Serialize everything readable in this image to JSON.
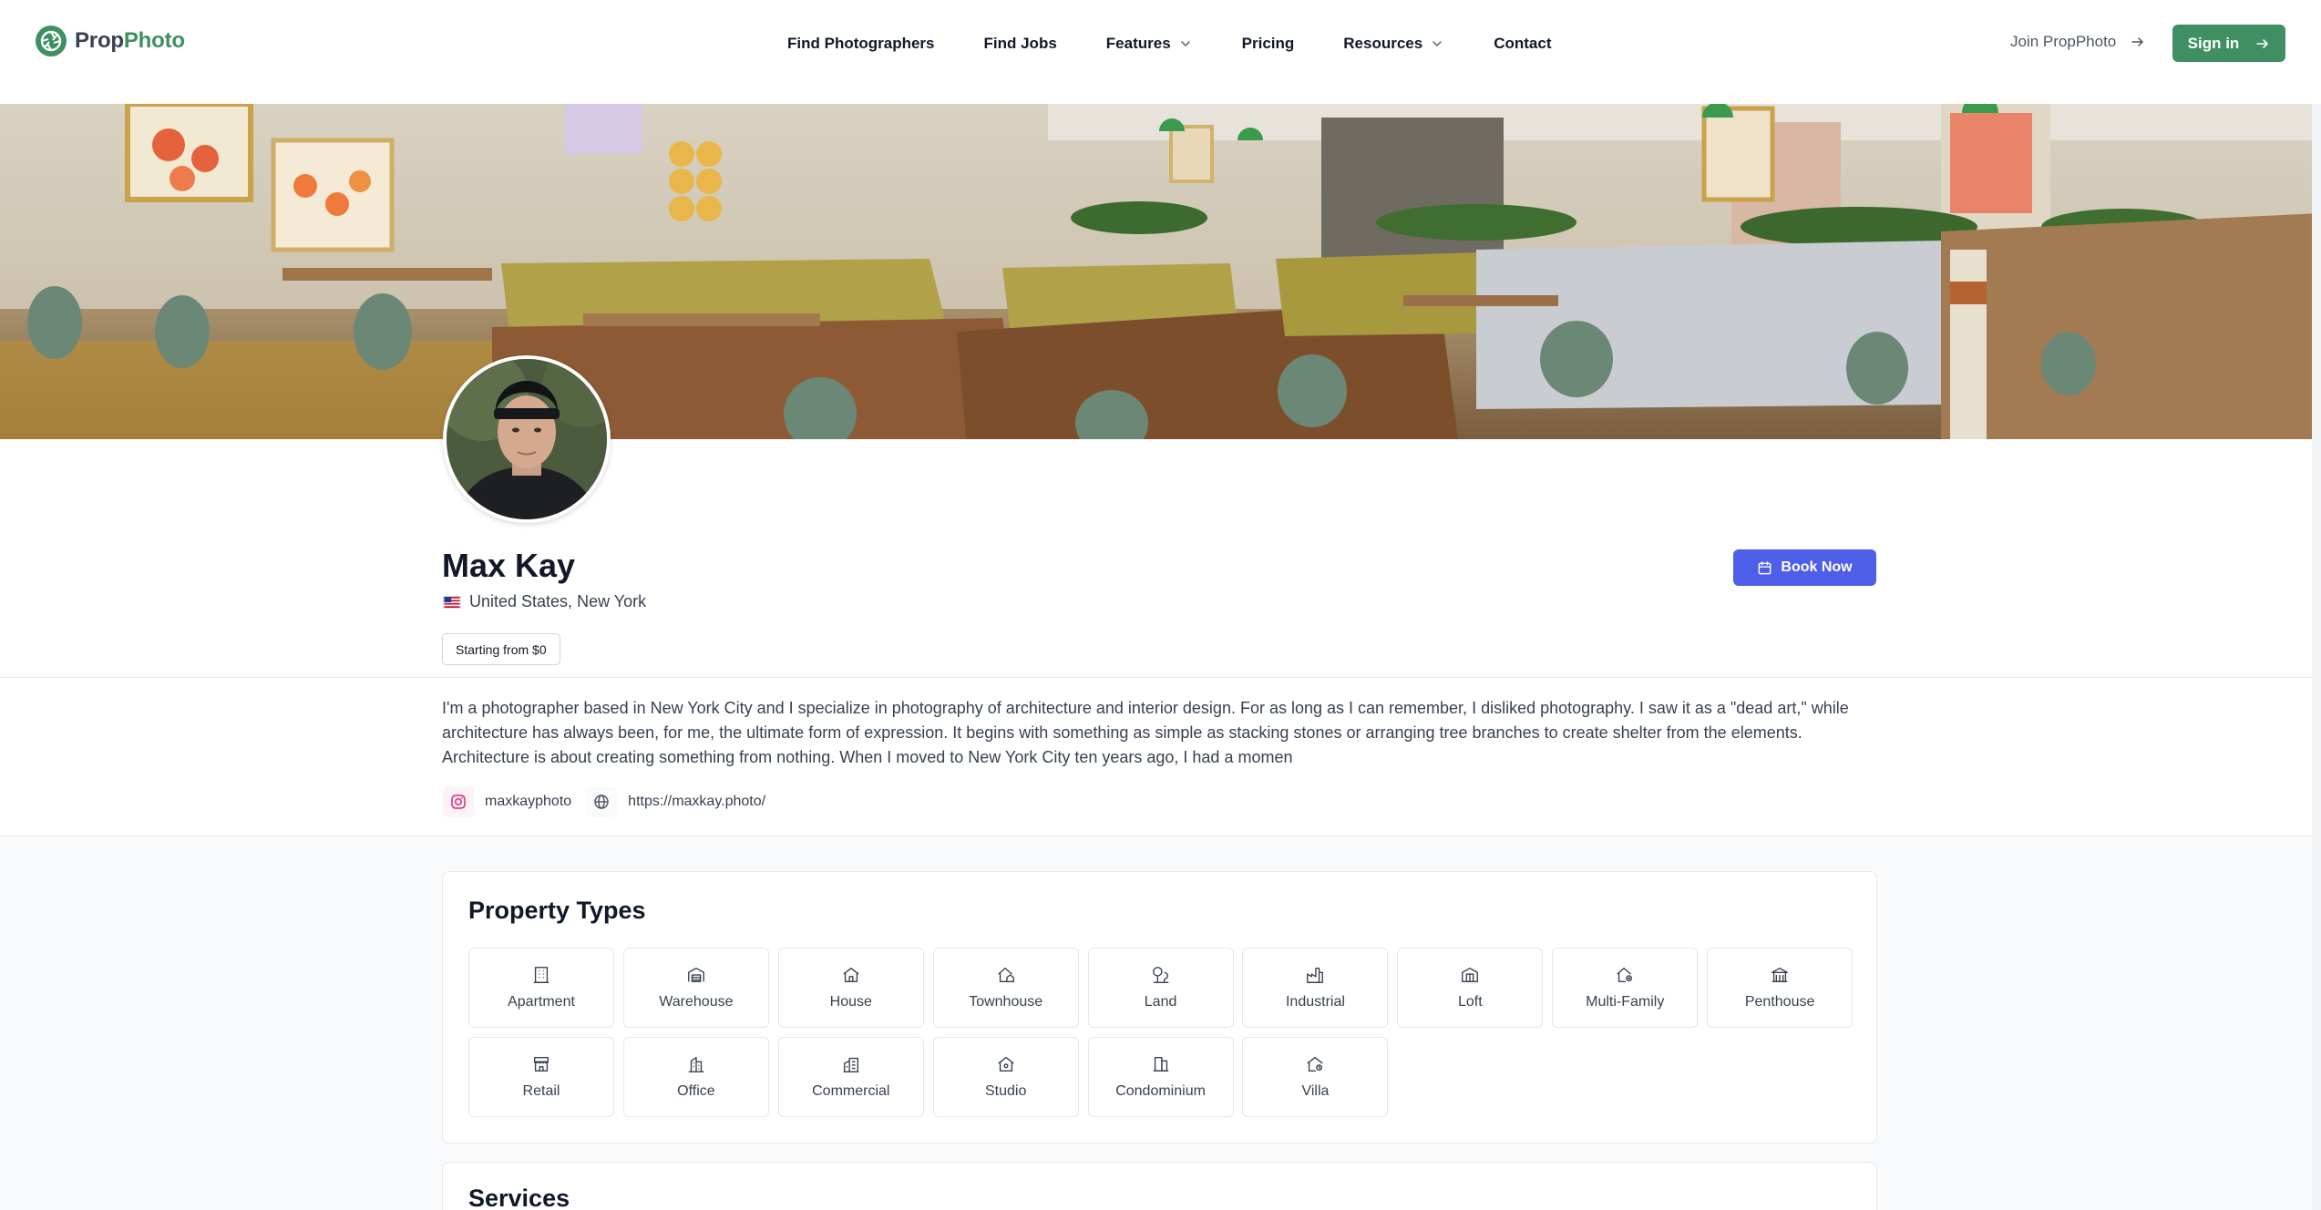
{
  "brand": {
    "name_part1": "Prop",
    "name_part2": "Photo",
    "accent": "#3f8f62"
  },
  "nav": {
    "items": [
      {
        "label": "Find Photographers",
        "dropdown": false
      },
      {
        "label": "Find Jobs",
        "dropdown": false
      },
      {
        "label": "Features",
        "dropdown": true
      },
      {
        "label": "Pricing",
        "dropdown": false
      },
      {
        "label": "Resources",
        "dropdown": true
      },
      {
        "label": "Contact",
        "dropdown": false
      }
    ],
    "join_label": "Join PropPhoto",
    "signin_label": "Sign in"
  },
  "profile": {
    "name": "Max Kay",
    "location": "United States, New York",
    "flag": "us-flag-icon",
    "price_badge": "Starting from $0",
    "book_label": "Book Now",
    "book_color": "#4f5ee8",
    "bio": "I'm a photographer based in New York City and I specialize in photography of architecture and interior design. For as long as I can remember, I disliked photography. I saw it as a \"dead art,\" while architecture has always been, for me, the ultimate form of expression. It begins with something as simple as stacking stones or arranging tree branches to create shelter from the elements. Architecture is about creating something from nothing. When I moved to New York City ten years ago, I had a momen",
    "instagram": "maxkayphoto",
    "website": "https://maxkay.photo/"
  },
  "property_types": {
    "title": "Property Types",
    "items": [
      {
        "label": "Apartment",
        "icon": "apartment-building-icon"
      },
      {
        "label": "Warehouse",
        "icon": "warehouse-icon"
      },
      {
        "label": "House",
        "icon": "house-icon"
      },
      {
        "label": "Townhouse",
        "icon": "townhouse-icon"
      },
      {
        "label": "Land",
        "icon": "trees-icon"
      },
      {
        "label": "Industrial",
        "icon": "factory-icon"
      },
      {
        "label": "Loft",
        "icon": "loft-icon"
      },
      {
        "label": "Multi-Family",
        "icon": "multi-family-icon"
      },
      {
        "label": "Penthouse",
        "icon": "penthouse-icon"
      },
      {
        "label": "Retail",
        "icon": "store-icon"
      },
      {
        "label": "Office",
        "icon": "office-building-icon"
      },
      {
        "label": "Commercial",
        "icon": "commercial-building-icon"
      },
      {
        "label": "Studio",
        "icon": "studio-icon"
      },
      {
        "label": "Condominium",
        "icon": "condominium-icon"
      },
      {
        "label": "Villa",
        "icon": "villa-icon"
      }
    ]
  },
  "services": {
    "title": "Services"
  }
}
